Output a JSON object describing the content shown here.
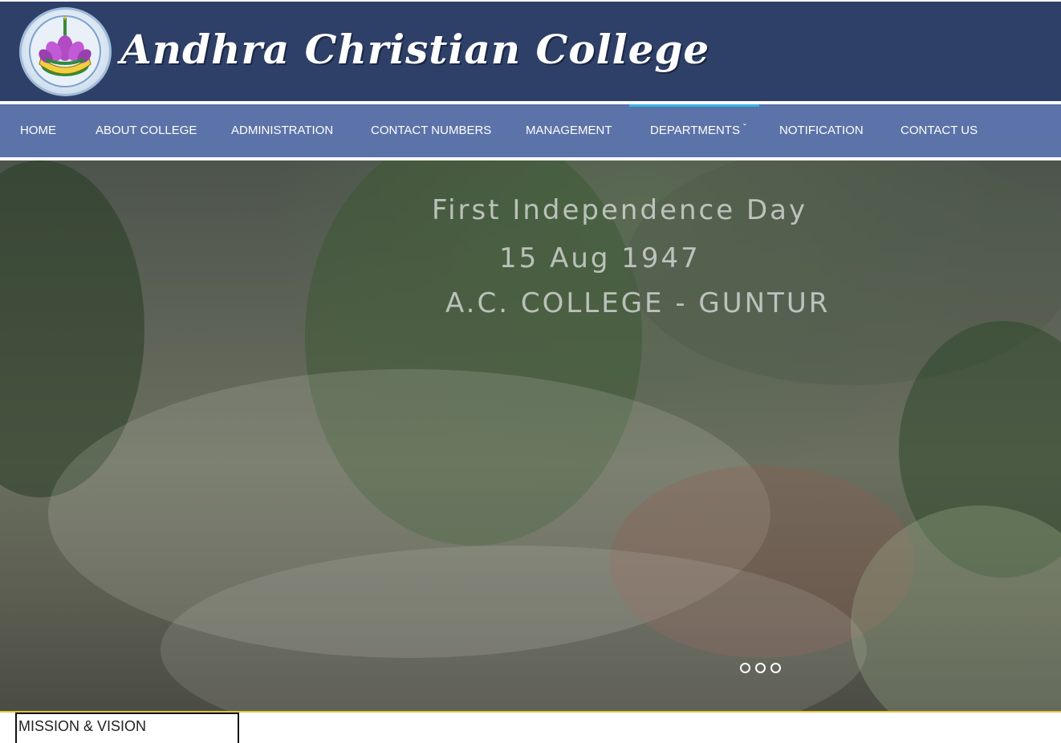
{
  "header": {
    "brand_title": "Andhra Christian College",
    "logo_icon": "college-seal-lotus-icon"
  },
  "nav": {
    "items": [
      {
        "label": "HOME"
      },
      {
        "label": "ABOUT COLLEGE"
      },
      {
        "label": "ADMINISTRATION"
      },
      {
        "label": "CONTACT NUMBERS"
      },
      {
        "label": "MANAGEMENT"
      },
      {
        "label": "DEPARTMENTS",
        "has_dropdown": true,
        "active": true
      },
      {
        "label": "NOTIFICATION"
      },
      {
        "label": "CONTACT US"
      }
    ]
  },
  "slider": {
    "caption_lines": [
      "First Independence Day",
      "15 Aug 1947",
      "A.C. COLLEGE - GUNTUR"
    ],
    "dot_count": 3
  },
  "section": {
    "mission_label": "MISSION & VISION"
  },
  "colors": {
    "header_bg": "#2f4068",
    "nav_bg": "#5b73a8",
    "active_indicator": "#38b6e6",
    "strip_accent": "#e6c23a"
  }
}
